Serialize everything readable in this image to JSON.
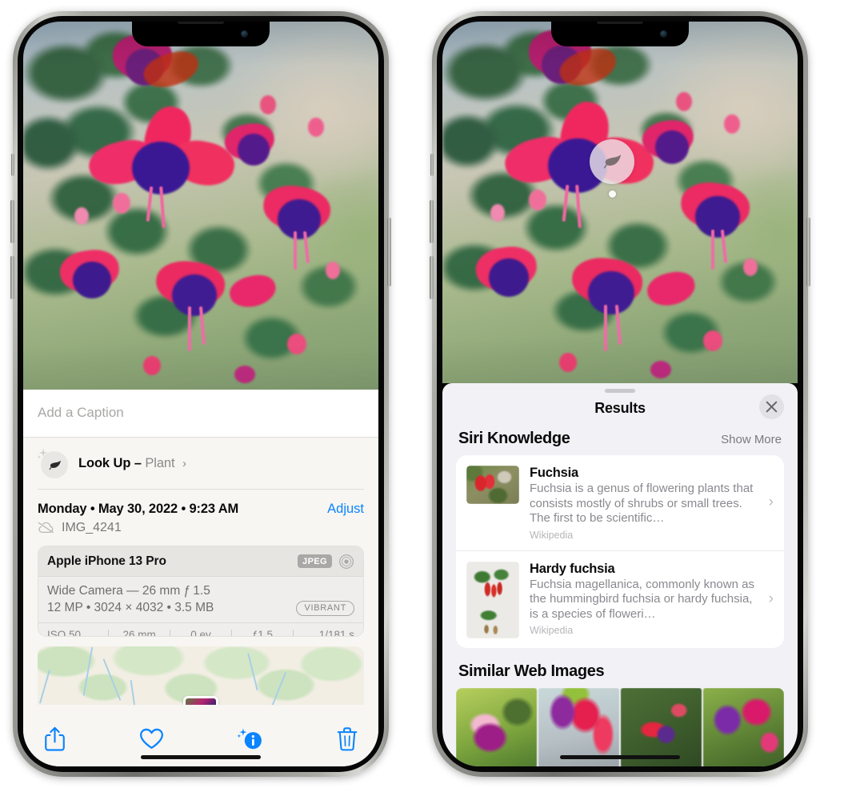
{
  "left_phone": {
    "caption": {
      "placeholder": "Add a Caption",
      "value": ""
    },
    "lookup": {
      "icon": "leaf-icon",
      "label": "Look Up –",
      "subject": "Plant",
      "chevron": "›"
    },
    "meta": {
      "date": "Monday • May 30, 2022 • 9:23 AM",
      "adjust_label": "Adjust",
      "cloud_icon": "cloud-slash-icon",
      "filename": "IMG_4241"
    },
    "camera": {
      "model": "Apple iPhone 13 Pro",
      "format_badge": "JPEG",
      "aperture_icon": "aperture-icon",
      "lens_line": "Wide Camera — 26 mm ƒ 1.5",
      "specs_line": "12 MP • 3024 × 4032 • 3.5 MB",
      "style_badge": "VIBRANT",
      "exif": [
        "ISO 50",
        "26 mm",
        "0 ev",
        "ƒ1.5",
        "1/181 s"
      ]
    },
    "toolbar": [
      {
        "name": "share-icon",
        "label": "Share"
      },
      {
        "name": "favorite-heart-icon",
        "label": "Favorite"
      },
      {
        "name": "info-icon",
        "label": "Info"
      },
      {
        "name": "trash-icon",
        "label": "Delete"
      }
    ]
  },
  "right_phone": {
    "visual_lookup_badge": {
      "icon": "leaf-icon"
    },
    "sheet": {
      "title": "Results",
      "close_icon": "close-icon",
      "sections": [
        {
          "title": "Siri Knowledge",
          "action_label": "Show More",
          "items": [
            {
              "title": "Fuchsia",
              "description": "Fuchsia is a genus of flowering plants that consists mostly of shrubs or small trees. The first to be scientific…",
              "source": "Wikipedia",
              "thumb": "fuchsia-wild-thumb",
              "chevron": "›"
            },
            {
              "title": "Hardy fuchsia",
              "description": "Fuchsia magellanica, commonly known as the hummingbird fuchsia or hardy fuchsia, is a species of floweri…",
              "source": "Wikipedia",
              "thumb": "hardy-fuchsia-thumb",
              "chevron": "›"
            }
          ]
        },
        {
          "title": "Similar Web Images",
          "items": [
            {
              "thumb": "web-image-1"
            },
            {
              "thumb": "web-image-2"
            },
            {
              "thumb": "web-image-3"
            },
            {
              "thumb": "web-image-4"
            }
          ]
        }
      ]
    }
  },
  "colors": {
    "accent_blue": "#0a84ff",
    "sheet_bg_left": "#f7f6f2",
    "sheet_bg_right": "#f2f1f6",
    "card_white": "#ffffff",
    "secondary_text": "#8a898f"
  }
}
